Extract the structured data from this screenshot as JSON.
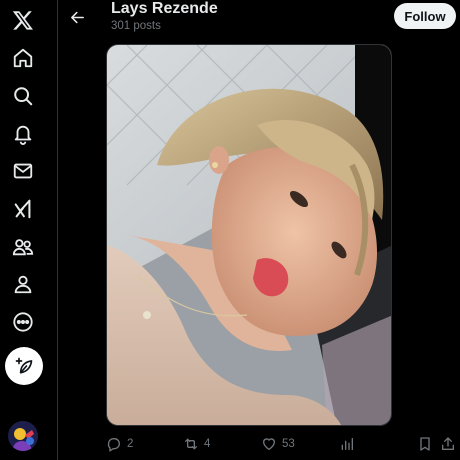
{
  "nav": {
    "items": [
      {
        "name": "x-logo-icon"
      },
      {
        "name": "home-icon"
      },
      {
        "name": "search-icon"
      },
      {
        "name": "notifications-icon"
      },
      {
        "name": "messages-icon"
      },
      {
        "name": "grok-icon"
      },
      {
        "name": "communities-icon"
      },
      {
        "name": "profile-icon"
      },
      {
        "name": "more-icon"
      }
    ],
    "compose_icon": "compose-post-icon"
  },
  "header": {
    "title": "Lays Rezende",
    "subtitle": "301 posts",
    "follow_label": "Follow"
  },
  "media": {
    "description_icon": "photo"
  },
  "actions": {
    "replies": "2",
    "reposts": "4",
    "likes": "53"
  },
  "colors": {
    "background": "#000000",
    "muted": "#71767b",
    "text": "#e7e9ea",
    "follow_bg": "#eff3f4",
    "divider": "#2f3336"
  }
}
